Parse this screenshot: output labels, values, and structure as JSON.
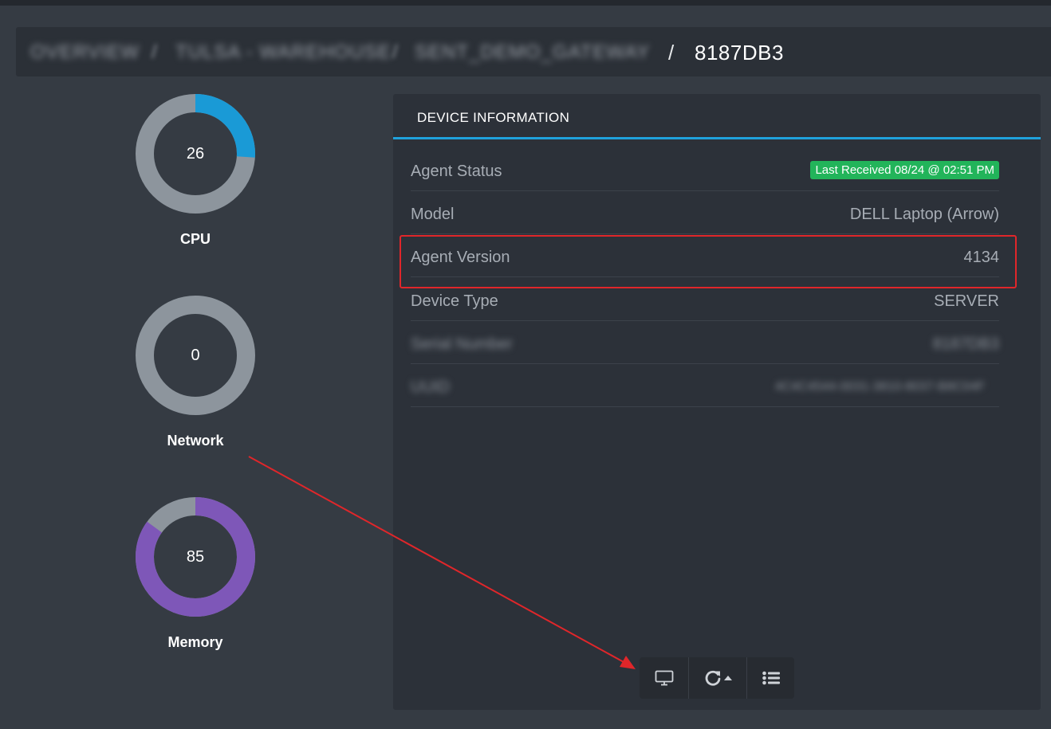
{
  "breadcrumb": {
    "blurred_items": [
      "OVERVIEW",
      "TULSA - WAREHOUSE",
      "SENT_DEMO_GATEWAY"
    ],
    "separator": "/",
    "current": "8187DB3"
  },
  "gauges": [
    {
      "label": "CPU",
      "value": "26",
      "percent": 26,
      "color": "#1a9ad6"
    },
    {
      "label": "Network",
      "value": "0",
      "percent": 0,
      "color": "#1a9ad6"
    },
    {
      "label": "Memory",
      "value": "85",
      "percent": 85,
      "color": "#7e57b8"
    }
  ],
  "gauge_track_color": "#8d959d",
  "device_info": {
    "title": "DEVICE INFORMATION",
    "accent_color": "#1fa2dc",
    "rows": [
      {
        "label": "Agent Status",
        "value": "Last Received 08/24 @ 02:51 PM",
        "badge_color": "#22b45a"
      },
      {
        "label": "Model",
        "value": "DELL Laptop (Arrow)"
      },
      {
        "label": "Agent Version",
        "value": "4134"
      },
      {
        "label": "Device Type",
        "value": "SERVER"
      },
      {
        "label": "Serial Number",
        "value": "8187DB3",
        "blurred": true
      },
      {
        "label": "UUID",
        "value": "4C4C4544-0031-3810-8037-B8C04F",
        "blurred": true
      }
    ]
  },
  "toolbar": {
    "buttons": [
      {
        "icon": "monitor-icon"
      },
      {
        "icon": "refresh-dropdown-icon"
      },
      {
        "icon": "list-icon"
      }
    ]
  },
  "annotation_color": "#e0262a"
}
